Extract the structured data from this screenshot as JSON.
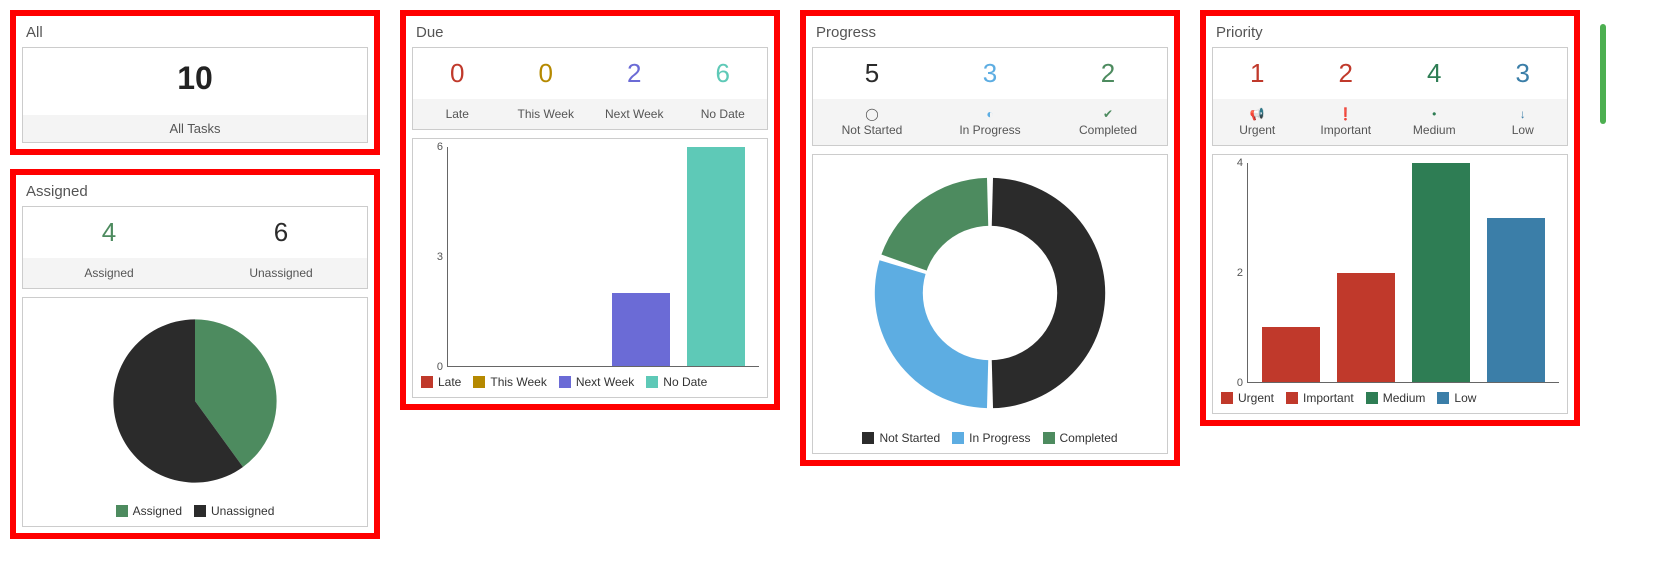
{
  "all": {
    "title": "All",
    "value": 10,
    "label": "All Tasks"
  },
  "assigned": {
    "title": "Assigned",
    "stats": [
      {
        "value": 4,
        "label": "Assigned",
        "color": "#4d8b5f"
      },
      {
        "value": 6,
        "label": "Unassigned",
        "color": "#2b2b2b"
      }
    ],
    "legend": [
      {
        "label": "Assigned",
        "color": "#4d8b5f"
      },
      {
        "label": "Unassigned",
        "color": "#2b2b2b"
      }
    ]
  },
  "due": {
    "title": "Due",
    "stats": [
      {
        "value": 0,
        "label": "Late",
        "color": "#c0392b"
      },
      {
        "value": 0,
        "label": "This Week",
        "color": "#b58900"
      },
      {
        "value": 2,
        "label": "Next Week",
        "color": "#6b6bd6"
      },
      {
        "value": 6,
        "label": "No Date",
        "color": "#5ec9b7"
      }
    ],
    "yticks": [
      0,
      3,
      6
    ],
    "legend": [
      {
        "label": "Late",
        "color": "#c0392b"
      },
      {
        "label": "This Week",
        "color": "#b58900"
      },
      {
        "label": "Next Week",
        "color": "#6b6bd6"
      },
      {
        "label": "No Date",
        "color": "#5ec9b7"
      }
    ]
  },
  "progress": {
    "title": "Progress",
    "stats": [
      {
        "value": 5,
        "label": "Not Started",
        "color": "#2b2b2b",
        "icon": "circle-empty"
      },
      {
        "value": 3,
        "label": "In Progress",
        "color": "#5dade2",
        "icon": "circle-half"
      },
      {
        "value": 2,
        "label": "Completed",
        "color": "#4d8b5f",
        "icon": "circle-check"
      }
    ],
    "legend": [
      {
        "label": "Not Started",
        "color": "#2b2b2b"
      },
      {
        "label": "In Progress",
        "color": "#5dade2"
      },
      {
        "label": "Completed",
        "color": "#4d8b5f"
      }
    ]
  },
  "priority": {
    "title": "Priority",
    "stats": [
      {
        "value": 1,
        "label": "Urgent",
        "color": "#c0392b",
        "icon": "megaphone"
      },
      {
        "value": 2,
        "label": "Important",
        "color": "#c0392b",
        "icon": "exclaim"
      },
      {
        "value": 4,
        "label": "Medium",
        "color": "#2e7d54",
        "icon": "dot"
      },
      {
        "value": 3,
        "label": "Low",
        "color": "#3b7ea8",
        "icon": "down"
      }
    ],
    "yticks": [
      0,
      2,
      4
    ],
    "legend": [
      {
        "label": "Urgent",
        "color": "#c0392b"
      },
      {
        "label": "Important",
        "color": "#c0392b"
      },
      {
        "label": "Medium",
        "color": "#2e7d54"
      },
      {
        "label": "Low",
        "color": "#3b7ea8"
      }
    ]
  },
  "chart_data": [
    {
      "type": "pie",
      "title": "Assigned",
      "series": [
        {
          "name": "Assigned",
          "value": 4,
          "color": "#4d8b5f"
        },
        {
          "name": "Unassigned",
          "value": 6,
          "color": "#2b2b2b"
        }
      ]
    },
    {
      "type": "bar",
      "title": "Due",
      "categories": [
        "Late",
        "This Week",
        "Next Week",
        "No Date"
      ],
      "values": [
        0,
        0,
        2,
        6
      ],
      "colors": [
        "#c0392b",
        "#b58900",
        "#6b6bd6",
        "#5ec9b7"
      ],
      "ylim": [
        0,
        6
      ],
      "xlabel": "",
      "ylabel": ""
    },
    {
      "type": "pie",
      "title": "Progress",
      "series": [
        {
          "name": "Not Started",
          "value": 5,
          "color": "#2b2b2b"
        },
        {
          "name": "In Progress",
          "value": 3,
          "color": "#5dade2"
        },
        {
          "name": "Completed",
          "value": 2,
          "color": "#4d8b5f"
        }
      ],
      "donut": true
    },
    {
      "type": "bar",
      "title": "Priority",
      "categories": [
        "Urgent",
        "Important",
        "Medium",
        "Low"
      ],
      "values": [
        1,
        2,
        4,
        3
      ],
      "colors": [
        "#c0392b",
        "#c0392b",
        "#2e7d54",
        "#3b7ea8"
      ],
      "ylim": [
        0,
        4
      ],
      "xlabel": "",
      "ylabel": ""
    }
  ]
}
